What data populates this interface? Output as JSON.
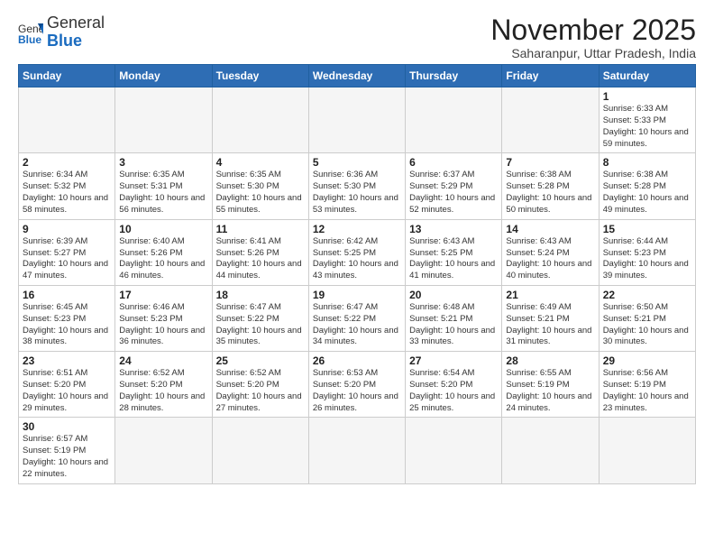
{
  "logo": {
    "general": "General",
    "blue": "Blue"
  },
  "header": {
    "month_year": "November 2025",
    "location": "Saharanpur, Uttar Pradesh, India"
  },
  "weekdays": [
    "Sunday",
    "Monday",
    "Tuesday",
    "Wednesday",
    "Thursday",
    "Friday",
    "Saturday"
  ],
  "weeks": [
    [
      {
        "day": "",
        "info": ""
      },
      {
        "day": "",
        "info": ""
      },
      {
        "day": "",
        "info": ""
      },
      {
        "day": "",
        "info": ""
      },
      {
        "day": "",
        "info": ""
      },
      {
        "day": "",
        "info": ""
      },
      {
        "day": "1",
        "info": "Sunrise: 6:33 AM\nSunset: 5:33 PM\nDaylight: 10 hours and 59 minutes."
      }
    ],
    [
      {
        "day": "2",
        "info": "Sunrise: 6:34 AM\nSunset: 5:32 PM\nDaylight: 10 hours and 58 minutes."
      },
      {
        "day": "3",
        "info": "Sunrise: 6:35 AM\nSunset: 5:31 PM\nDaylight: 10 hours and 56 minutes."
      },
      {
        "day": "4",
        "info": "Sunrise: 6:35 AM\nSunset: 5:30 PM\nDaylight: 10 hours and 55 minutes."
      },
      {
        "day": "5",
        "info": "Sunrise: 6:36 AM\nSunset: 5:30 PM\nDaylight: 10 hours and 53 minutes."
      },
      {
        "day": "6",
        "info": "Sunrise: 6:37 AM\nSunset: 5:29 PM\nDaylight: 10 hours and 52 minutes."
      },
      {
        "day": "7",
        "info": "Sunrise: 6:38 AM\nSunset: 5:28 PM\nDaylight: 10 hours and 50 minutes."
      },
      {
        "day": "8",
        "info": "Sunrise: 6:38 AM\nSunset: 5:28 PM\nDaylight: 10 hours and 49 minutes."
      }
    ],
    [
      {
        "day": "9",
        "info": "Sunrise: 6:39 AM\nSunset: 5:27 PM\nDaylight: 10 hours and 47 minutes."
      },
      {
        "day": "10",
        "info": "Sunrise: 6:40 AM\nSunset: 5:26 PM\nDaylight: 10 hours and 46 minutes."
      },
      {
        "day": "11",
        "info": "Sunrise: 6:41 AM\nSunset: 5:26 PM\nDaylight: 10 hours and 44 minutes."
      },
      {
        "day": "12",
        "info": "Sunrise: 6:42 AM\nSunset: 5:25 PM\nDaylight: 10 hours and 43 minutes."
      },
      {
        "day": "13",
        "info": "Sunrise: 6:43 AM\nSunset: 5:25 PM\nDaylight: 10 hours and 41 minutes."
      },
      {
        "day": "14",
        "info": "Sunrise: 6:43 AM\nSunset: 5:24 PM\nDaylight: 10 hours and 40 minutes."
      },
      {
        "day": "15",
        "info": "Sunrise: 6:44 AM\nSunset: 5:23 PM\nDaylight: 10 hours and 39 minutes."
      }
    ],
    [
      {
        "day": "16",
        "info": "Sunrise: 6:45 AM\nSunset: 5:23 PM\nDaylight: 10 hours and 38 minutes."
      },
      {
        "day": "17",
        "info": "Sunrise: 6:46 AM\nSunset: 5:23 PM\nDaylight: 10 hours and 36 minutes."
      },
      {
        "day": "18",
        "info": "Sunrise: 6:47 AM\nSunset: 5:22 PM\nDaylight: 10 hours and 35 minutes."
      },
      {
        "day": "19",
        "info": "Sunrise: 6:47 AM\nSunset: 5:22 PM\nDaylight: 10 hours and 34 minutes."
      },
      {
        "day": "20",
        "info": "Sunrise: 6:48 AM\nSunset: 5:21 PM\nDaylight: 10 hours and 33 minutes."
      },
      {
        "day": "21",
        "info": "Sunrise: 6:49 AM\nSunset: 5:21 PM\nDaylight: 10 hours and 31 minutes."
      },
      {
        "day": "22",
        "info": "Sunrise: 6:50 AM\nSunset: 5:21 PM\nDaylight: 10 hours and 30 minutes."
      }
    ],
    [
      {
        "day": "23",
        "info": "Sunrise: 6:51 AM\nSunset: 5:20 PM\nDaylight: 10 hours and 29 minutes."
      },
      {
        "day": "24",
        "info": "Sunrise: 6:52 AM\nSunset: 5:20 PM\nDaylight: 10 hours and 28 minutes."
      },
      {
        "day": "25",
        "info": "Sunrise: 6:52 AM\nSunset: 5:20 PM\nDaylight: 10 hours and 27 minutes."
      },
      {
        "day": "26",
        "info": "Sunrise: 6:53 AM\nSunset: 5:20 PM\nDaylight: 10 hours and 26 minutes."
      },
      {
        "day": "27",
        "info": "Sunrise: 6:54 AM\nSunset: 5:20 PM\nDaylight: 10 hours and 25 minutes."
      },
      {
        "day": "28",
        "info": "Sunrise: 6:55 AM\nSunset: 5:19 PM\nDaylight: 10 hours and 24 minutes."
      },
      {
        "day": "29",
        "info": "Sunrise: 6:56 AM\nSunset: 5:19 PM\nDaylight: 10 hours and 23 minutes."
      }
    ],
    [
      {
        "day": "30",
        "info": "Sunrise: 6:57 AM\nSunset: 5:19 PM\nDaylight: 10 hours and 22 minutes."
      },
      {
        "day": "",
        "info": ""
      },
      {
        "day": "",
        "info": ""
      },
      {
        "day": "",
        "info": ""
      },
      {
        "day": "",
        "info": ""
      },
      {
        "day": "",
        "info": ""
      },
      {
        "day": "",
        "info": ""
      }
    ]
  ]
}
